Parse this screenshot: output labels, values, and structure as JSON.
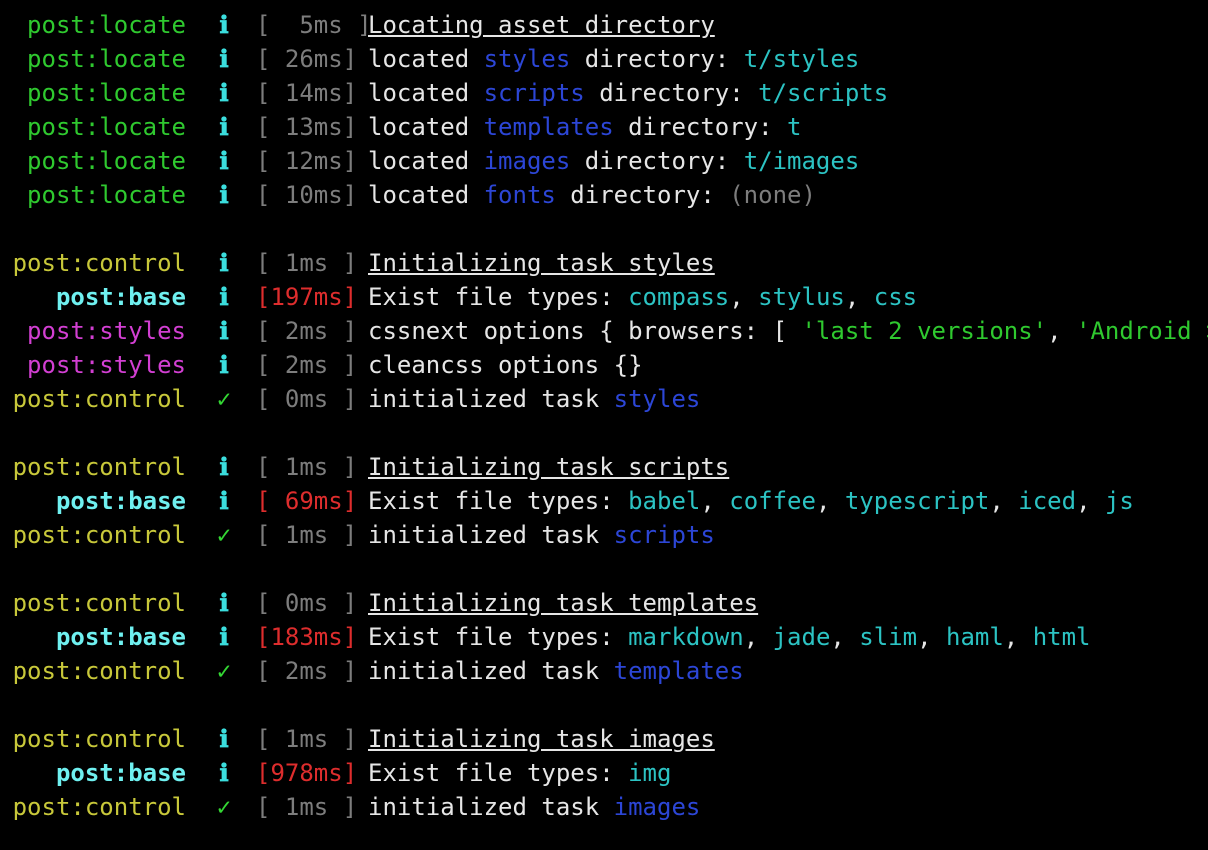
{
  "colors": {
    "locate": "#2fc92f",
    "control": "#c8c83a",
    "base": "#6ff0f0",
    "styles": "#d23fd2",
    "info_icon": "#3bdede",
    "check_icon": "#33d633",
    "time": "#7d7d7d",
    "time_slow": "#de2d2d",
    "text": "#e6e6e6",
    "blue": "#2c46d6",
    "cyan": "#2cc3c3",
    "green": "#2fc92f",
    "gray": "#7d7d7d"
  },
  "icons": {
    "info": "ℹ",
    "success": "✓"
  },
  "lines": [
    {
      "ns": "post:locate",
      "style": "locate",
      "icon": "info",
      "time": "[  5ms ]",
      "msg": [
        {
          "t": "Locating asset directory",
          "s": "text",
          "u": true
        }
      ]
    },
    {
      "ns": "post:locate",
      "style": "locate",
      "icon": "info",
      "time": "[ 26ms]",
      "msg": [
        {
          "t": "located ",
          "s": "text"
        },
        {
          "t": "styles",
          "s": "blue"
        },
        {
          "t": " directory: ",
          "s": "text"
        },
        {
          "t": "t/styles",
          "s": "cyan"
        }
      ]
    },
    {
      "ns": "post:locate",
      "style": "locate",
      "icon": "info",
      "time": "[ 14ms]",
      "msg": [
        {
          "t": "located ",
          "s": "text"
        },
        {
          "t": "scripts",
          "s": "blue"
        },
        {
          "t": " directory: ",
          "s": "text"
        },
        {
          "t": "t/scripts",
          "s": "cyan"
        }
      ]
    },
    {
      "ns": "post:locate",
      "style": "locate",
      "icon": "info",
      "time": "[ 13ms]",
      "msg": [
        {
          "t": "located ",
          "s": "text"
        },
        {
          "t": "templates",
          "s": "blue"
        },
        {
          "t": " directory: ",
          "s": "text"
        },
        {
          "t": "t",
          "s": "cyan"
        }
      ]
    },
    {
      "ns": "post:locate",
      "style": "locate",
      "icon": "info",
      "time": "[ 12ms]",
      "msg": [
        {
          "t": "located ",
          "s": "text"
        },
        {
          "t": "images",
          "s": "blue"
        },
        {
          "t": " directory: ",
          "s": "text"
        },
        {
          "t": "t/images",
          "s": "cyan"
        }
      ]
    },
    {
      "ns": "post:locate",
      "style": "locate",
      "icon": "info",
      "time": "[ 10ms]",
      "msg": [
        {
          "t": "located ",
          "s": "text"
        },
        {
          "t": "fonts",
          "s": "blue"
        },
        {
          "t": " directory: ",
          "s": "text"
        },
        {
          "t": "(none)",
          "s": "gray"
        }
      ]
    },
    null,
    {
      "ns": "post:control",
      "style": "control",
      "icon": "info",
      "time": "[ 1ms ]",
      "msg": [
        {
          "t": "Initializing task styles",
          "s": "text",
          "u": true
        }
      ]
    },
    {
      "ns": "post:base",
      "style": "base",
      "icon": "info",
      "time": "[197ms]",
      "slow": true,
      "msg": [
        {
          "t": "Exist file types: ",
          "s": "text"
        },
        {
          "t": "compass",
          "s": "cyan"
        },
        {
          "t": ", ",
          "s": "text"
        },
        {
          "t": "stylus",
          "s": "cyan"
        },
        {
          "t": ", ",
          "s": "text"
        },
        {
          "t": "css",
          "s": "cyan"
        }
      ]
    },
    {
      "ns": "post:styles",
      "style": "styles",
      "icon": "info",
      "time": "[ 2ms ]",
      "msg": [
        {
          "t": "cssnext options { browsers: [ ",
          "s": "text"
        },
        {
          "t": "'last 2 versions'",
          "s": "green"
        },
        {
          "t": ", ",
          "s": "text"
        },
        {
          "t": "'Android >=",
          "s": "green"
        }
      ]
    },
    {
      "ns": "post:styles",
      "style": "styles",
      "icon": "info",
      "time": "[ 2ms ]",
      "msg": [
        {
          "t": "cleancss options {}",
          "s": "text"
        }
      ]
    },
    {
      "ns": "post:control",
      "style": "control",
      "icon": "success",
      "time": "[ 0ms ]",
      "msg": [
        {
          "t": "initialized task ",
          "s": "text"
        },
        {
          "t": "styles",
          "s": "blue"
        }
      ]
    },
    null,
    {
      "ns": "post:control",
      "style": "control",
      "icon": "info",
      "time": "[ 1ms ]",
      "msg": [
        {
          "t": "Initializing task scripts",
          "s": "text",
          "u": true
        }
      ]
    },
    {
      "ns": "post:base",
      "style": "base",
      "icon": "info",
      "time": "[ 69ms]",
      "slow": true,
      "msg": [
        {
          "t": "Exist file types: ",
          "s": "text"
        },
        {
          "t": "babel",
          "s": "cyan"
        },
        {
          "t": ", ",
          "s": "text"
        },
        {
          "t": "coffee",
          "s": "cyan"
        },
        {
          "t": ", ",
          "s": "text"
        },
        {
          "t": "typescript",
          "s": "cyan"
        },
        {
          "t": ", ",
          "s": "text"
        },
        {
          "t": "iced",
          "s": "cyan"
        },
        {
          "t": ", ",
          "s": "text"
        },
        {
          "t": "js",
          "s": "cyan"
        }
      ]
    },
    {
      "ns": "post:control",
      "style": "control",
      "icon": "success",
      "time": "[ 1ms ]",
      "msg": [
        {
          "t": "initialized task ",
          "s": "text"
        },
        {
          "t": "scripts",
          "s": "blue"
        }
      ]
    },
    null,
    {
      "ns": "post:control",
      "style": "control",
      "icon": "info",
      "time": "[ 0ms ]",
      "msg": [
        {
          "t": "Initializing task templates",
          "s": "text",
          "u": true
        }
      ]
    },
    {
      "ns": "post:base",
      "style": "base",
      "icon": "info",
      "time": "[183ms]",
      "slow": true,
      "msg": [
        {
          "t": "Exist file types: ",
          "s": "text"
        },
        {
          "t": "markdown",
          "s": "cyan"
        },
        {
          "t": ", ",
          "s": "text"
        },
        {
          "t": "jade",
          "s": "cyan"
        },
        {
          "t": ", ",
          "s": "text"
        },
        {
          "t": "slim",
          "s": "cyan"
        },
        {
          "t": ", ",
          "s": "text"
        },
        {
          "t": "haml",
          "s": "cyan"
        },
        {
          "t": ", ",
          "s": "text"
        },
        {
          "t": "html",
          "s": "cyan"
        }
      ]
    },
    {
      "ns": "post:control",
      "style": "control",
      "icon": "success",
      "time": "[ 2ms ]",
      "msg": [
        {
          "t": "initialized task ",
          "s": "text"
        },
        {
          "t": "templates",
          "s": "blue"
        }
      ]
    },
    null,
    {
      "ns": "post:control",
      "style": "control",
      "icon": "info",
      "time": "[ 1ms ]",
      "msg": [
        {
          "t": "Initializing task images",
          "s": "text",
          "u": true
        }
      ]
    },
    {
      "ns": "post:base",
      "style": "base",
      "icon": "info",
      "time": "[978ms]",
      "slow": true,
      "msg": [
        {
          "t": "Exist file types: ",
          "s": "text"
        },
        {
          "t": "img",
          "s": "cyan"
        }
      ]
    },
    {
      "ns": "post:control",
      "style": "control",
      "icon": "success",
      "time": "[ 1ms ]",
      "msg": [
        {
          "t": "initialized task ",
          "s": "text"
        },
        {
          "t": "images",
          "s": "blue"
        }
      ]
    }
  ]
}
